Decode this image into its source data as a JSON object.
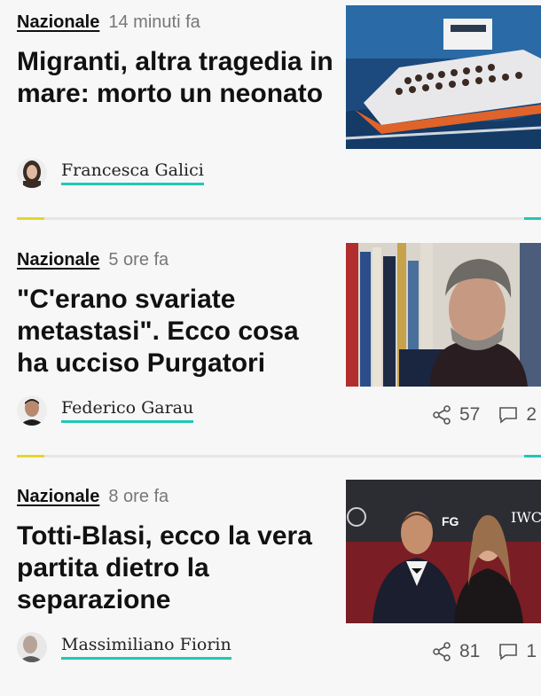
{
  "articles": [
    {
      "category": "Nazionale",
      "time": "14 minuti fa",
      "title": "Migranti, altra tragedia in mare: morto un neonato",
      "author": "Francesca Galici",
      "image": "migrant-boat-photo"
    },
    {
      "category": "Nazionale",
      "time": "5 ore fa",
      "title": "\"C'erano svariate metastasi\". Ecco cosa ha ucciso Purgatori",
      "author": "Federico Garau",
      "image": "man-in-bookstore-photo",
      "shares": "57",
      "comments": "2"
    },
    {
      "category": "Nazionale",
      "time": "8 ore fa",
      "title": "Totti-Blasi, ecco la vera partita dietro la separazione",
      "author": "Massimiliano Fiorin",
      "image": "couple-red-carpet-photo",
      "shares": "81",
      "comments": "1"
    }
  ],
  "colors": {
    "underline": "#1fc8b4",
    "accent_yellow": "#e6d62a",
    "divider": "#e6e6e6"
  }
}
